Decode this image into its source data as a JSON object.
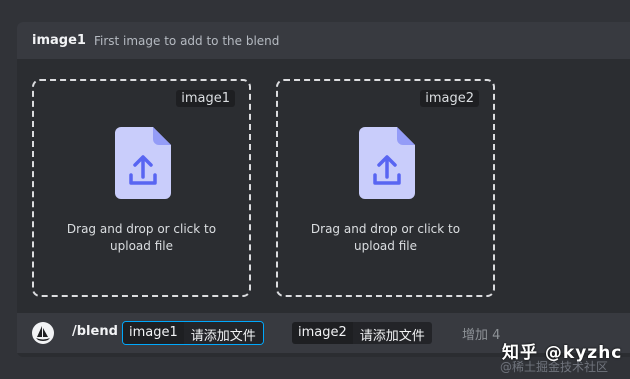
{
  "option": {
    "name": "image1",
    "description": "First image to add to the blend"
  },
  "dropzones": [
    {
      "tag": "image1",
      "text_line1": "Drag and drop or click to",
      "text_line2": "upload file",
      "icon": "file-upload-icon"
    },
    {
      "tag": "image2",
      "text_line1": "Drag and drop or click to",
      "text_line2": "upload file",
      "icon": "file-upload-icon"
    }
  ],
  "command": {
    "name": "/blend",
    "params": [
      {
        "key": "image1",
        "value": "请添加文件",
        "active": true
      },
      {
        "key": "image2",
        "value": "请添加文件",
        "active": false
      }
    ],
    "more": "增加 4"
  },
  "watermark": {
    "line1": "知乎 @kyzhc",
    "line2": "@稀土掘金技术社区"
  },
  "colors": {
    "background": "#313338",
    "panel": "#2b2d31",
    "header": "#383a40",
    "accent": "#00a8fc",
    "icon": "#c9cdfb"
  }
}
